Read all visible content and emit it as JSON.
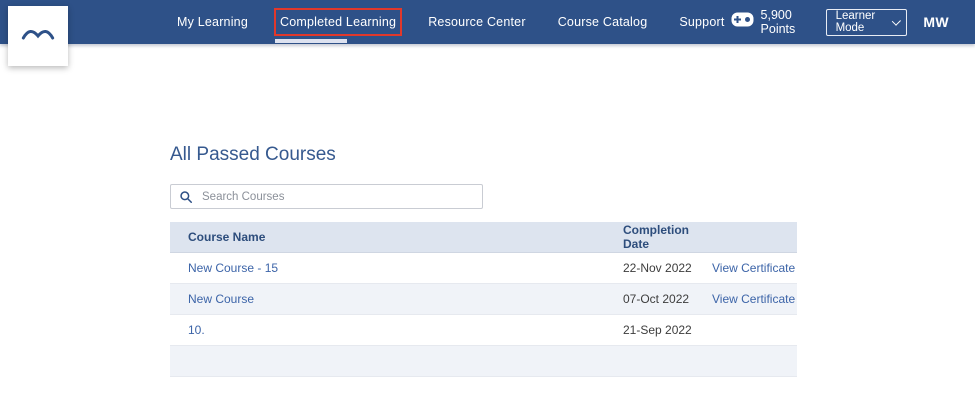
{
  "header": {
    "nav": [
      {
        "label": "My Learning"
      },
      {
        "label": "Completed Learning"
      },
      {
        "label": "Resource Center"
      },
      {
        "label": "Course Catalog"
      },
      {
        "label": "Support"
      }
    ],
    "active_tab": "Completed Learning",
    "points": "5,900 Points",
    "mode_select": {
      "value": "Learner Mode"
    },
    "user_initials": "MW"
  },
  "main": {
    "title": "All Passed Courses",
    "search": {
      "placeholder": "Search Courses"
    },
    "table": {
      "columns": {
        "course": "Course Name",
        "date": "Completion Date"
      },
      "rows": [
        {
          "course": "New Course - 15",
          "date": "22-Nov 2022",
          "certificate": "View Certificate"
        },
        {
          "course": "New Course",
          "date": "07-Oct 2022",
          "certificate": "View Certificate"
        },
        {
          "course": "10.",
          "date": "21-Sep 2022",
          "certificate": ""
        },
        {
          "course": "",
          "date": "",
          "certificate": ""
        }
      ]
    }
  },
  "colors": {
    "navbar": "#2e5188",
    "active_highlight_border": "#e2382b",
    "active_underline": "#dde2f0",
    "heading": "#36598f",
    "table_header_bg": "#dde4ef",
    "link": "#3c64a8",
    "striped_row_bg": "#f0f3f8"
  }
}
